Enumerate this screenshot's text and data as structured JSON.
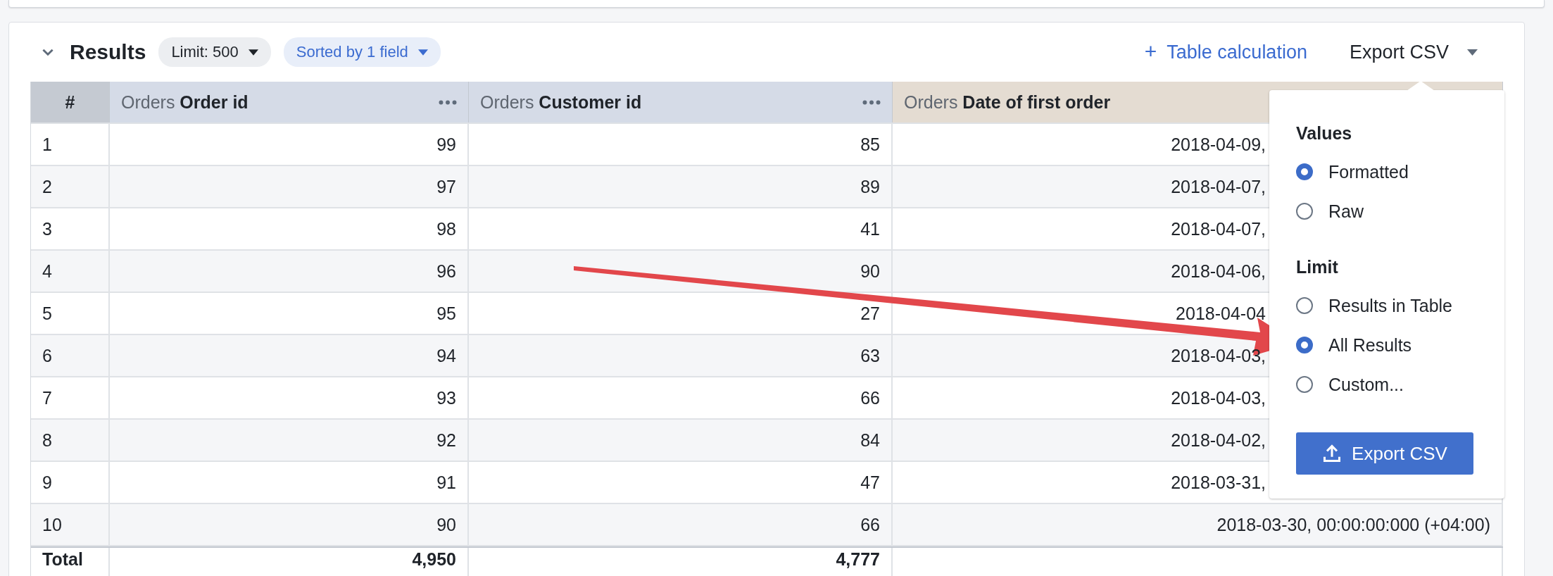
{
  "results": {
    "title": "Results",
    "expanded": true,
    "limit_pill": "Limit: 500",
    "sort_pill": "Sorted by 1 field",
    "table_calc": {
      "icon": "+",
      "label": "Table calculation"
    },
    "export_menu": {
      "label": "Export CSV",
      "open": true
    }
  },
  "table": {
    "columns": [
      {
        "kind": "index",
        "label": "#"
      },
      {
        "kind": "dimension",
        "view": "Orders",
        "field": "Order id",
        "menu": true
      },
      {
        "kind": "dimension",
        "view": "Orders",
        "field": "Customer id",
        "menu": true
      },
      {
        "kind": "date",
        "view": "Orders",
        "field": "Date of first order",
        "menu": false
      }
    ],
    "rows": [
      [
        "1",
        "99",
        "85",
        "2018-04-09,"
      ],
      [
        "2",
        "97",
        "89",
        "2018-04-07,"
      ],
      [
        "3",
        "98",
        "41",
        "2018-04-07,"
      ],
      [
        "4",
        "96",
        "90",
        "2018-04-06,"
      ],
      [
        "5",
        "95",
        "27",
        "2018-04-04"
      ],
      [
        "6",
        "94",
        "63",
        "2018-04-03,"
      ],
      [
        "7",
        "93",
        "66",
        "2018-04-03,"
      ],
      [
        "8",
        "92",
        "84",
        "2018-04-02,"
      ],
      [
        "9",
        "91",
        "47",
        "2018-03-31,"
      ],
      [
        "10",
        "90",
        "66",
        "2018-03-30, 00:00:00:000 (+04:00)"
      ]
    ],
    "total": [
      "Total",
      "4,950",
      "4,777"
    ]
  },
  "export_dropdown": {
    "sections": [
      {
        "title": "Values",
        "options": [
          {
            "label": "Formatted",
            "selected": true
          },
          {
            "label": "Raw",
            "selected": false
          }
        ]
      },
      {
        "title": "Limit",
        "options": [
          {
            "label": "Results in Table",
            "selected": false
          },
          {
            "label": "All Results",
            "selected": true
          },
          {
            "label": "Custom...",
            "selected": false
          }
        ]
      }
    ],
    "button": "Export CSV"
  }
}
